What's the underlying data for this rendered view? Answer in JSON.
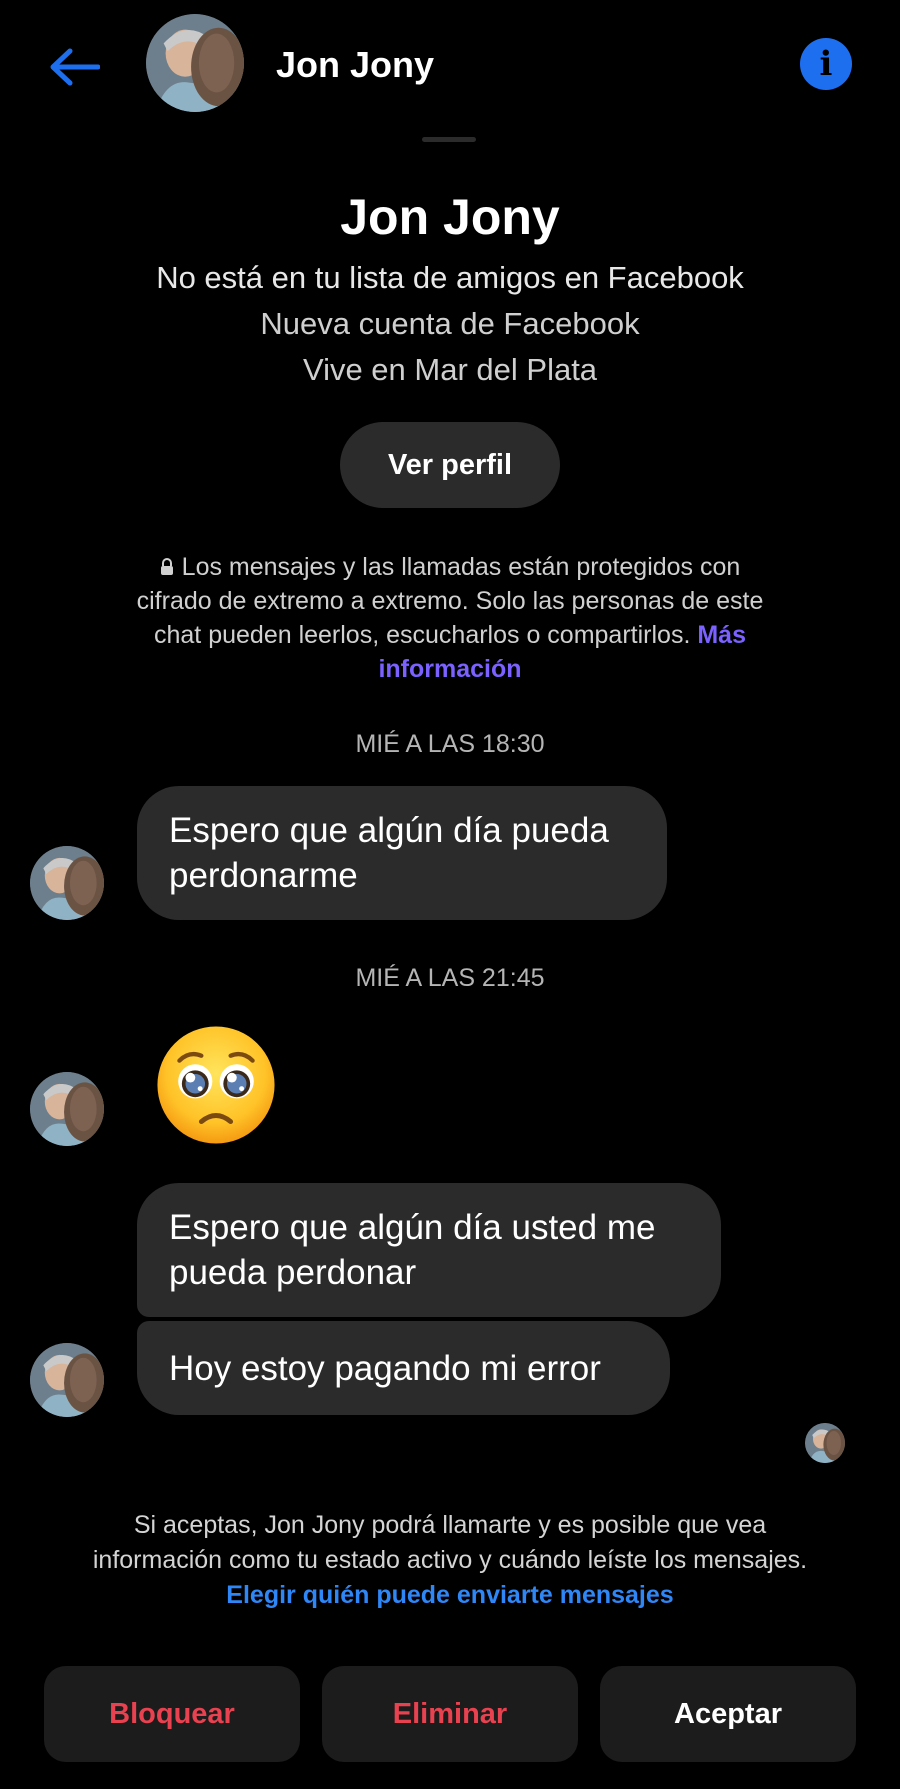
{
  "header": {
    "name": "Jon Jony",
    "back_icon": "arrow-left-icon",
    "info_icon": "info-icon",
    "accent": "#1e6ff0"
  },
  "profile": {
    "name": "Jon Jony",
    "line1": "No está en tu lista de amigos en Facebook",
    "line2": "Nueva cuenta de Facebook",
    "line3": "Vive en Mar del Plata",
    "view_profile_label": "Ver perfil"
  },
  "encryption": {
    "text": "Los mensajes y las llamadas están protegidos con cifrado de extremo a extremo. Solo las personas de este chat pueden leerlos, escucharlos o compartirlos.",
    "link": "Más información",
    "icon": "lock-icon"
  },
  "messages": {
    "timestamp1": "MIÉ A LAS 18:30",
    "msg1": "Espero que algún día pueda perdonarme",
    "timestamp2": "MIÉ A LAS 21:45",
    "emoji": "pleading-face-emoji",
    "msg2": "Espero que algún día usted me pueda perdonar",
    "msg3": "Hoy estoy pagando mi error"
  },
  "consent": {
    "text": "Si aceptas, Jon Jony podrá llamarte y es posible que vea información como tu estado activo y cuándo leíste los mensajes.",
    "link": "Elegir quién puede enviarte mensajes"
  },
  "actions": {
    "block": "Bloquear",
    "delete": "Eliminar",
    "accept": "Aceptar",
    "danger_color": "#e8414f"
  }
}
